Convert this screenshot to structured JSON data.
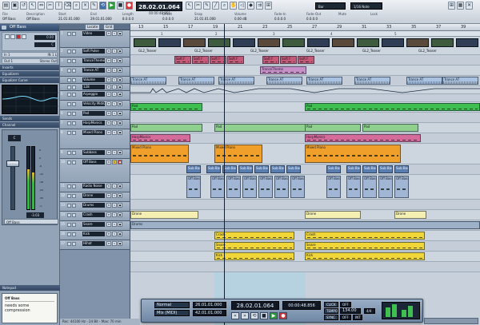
{
  "topbar": {
    "counter": "28.02.01.064",
    "sub_counter": "00:00:48.856",
    "snap_mode": "Bar",
    "quantize": "1/16 Note",
    "icons": [
      "file-icon",
      "save-icon",
      "undo-icon",
      "cursor-icon",
      "range-icon",
      "cut-icon",
      "glue-icon",
      "erase-icon",
      "zoom-icon",
      "mute-icon",
      "pencil-icon",
      "play-icon",
      "stop-icon",
      "record-icon"
    ],
    "info": [
      {
        "h": "File",
        "v": "Off Bass"
      },
      {
        "h": "Description",
        "v": "Off Bass"
      },
      {
        "h": "Start",
        "v": "21.01.01.000"
      },
      {
        "h": "End",
        "v": "29.01.01.000"
      },
      {
        "h": "Length",
        "v": "8.0.0.0"
      },
      {
        "h": "Offset",
        "v": "0.0.0.0"
      },
      {
        "h": "Snap",
        "v": "21.01.01.000"
      },
      {
        "h": "Volume",
        "v": "0.00 dB"
      },
      {
        "h": "Fade-In",
        "v": "0.0.0.0"
      },
      {
        "h": "Fade-Out",
        "v": "0.0.0.0"
      },
      {
        "h": "Mute",
        "v": ""
      },
      {
        "h": "Lock",
        "v": ""
      }
    ]
  },
  "inspector": {
    "track_name": "Off Bass",
    "rows": [
      "Volume",
      "Pan"
    ],
    "in_label": "In 1",
    "in_value": "IN 1 L",
    "out_label": "Out 1",
    "out_value": "Stereo Out",
    "sections": {
      "inserts": "Inserts",
      "equalizers": "Equalizers",
      "eq_curve": "Equalizer Curve",
      "sends": "Sends",
      "channel": "Channel",
      "notepad": "Notepad"
    },
    "fader_value": "-3.03",
    "fader_left": "0.00",
    "channel_name": "Off Bass",
    "notepad_title": "Off Bass",
    "notepad_text": "needs some compression"
  },
  "tracklist": {
    "header_label": "Locate",
    "header_value": "Grid",
    "tracks": [
      {
        "num": "1",
        "name": "Video",
        "h": 22
      },
      {
        "num": "2",
        "name": "Soft Pulse",
        "h": 12
      },
      {
        "num": "3",
        "name": "TranceTheme",
        "h": 12
      },
      {
        "num": "4",
        "name": "Trance AT",
        "h": 12
      },
      {
        "num": "",
        "name": "Volume",
        "h": 9
      },
      {
        "num": "",
        "name": "128",
        "h": 9
      },
      {
        "num": "5",
        "name": "Arpeggio",
        "h": 12
      },
      {
        "num": "",
        "name": "Velocity MidiControl",
        "h": 12
      },
      {
        "num": "6",
        "name": "Pad",
        "h": 12
      },
      {
        "num": "7",
        "name": "HarpMonics",
        "h": 12
      },
      {
        "num": "8",
        "name": "Mixed Piano",
        "h": 25
      },
      {
        "num": "9",
        "name": "Subbass",
        "h": 12
      },
      {
        "num": "10",
        "name": "Off Bass",
        "h": 30
      },
      {
        "num": "11",
        "name": "Radio Noise",
        "h": 12
      },
      {
        "num": "12",
        "name": "Drone",
        "h": 12
      },
      {
        "num": "13",
        "name": "Drums",
        "h": 12
      },
      {
        "num": "14",
        "name": "Crash",
        "h": 12
      },
      {
        "num": "15",
        "name": "Snare",
        "h": 12
      },
      {
        "num": "16",
        "name": "Kick",
        "h": 12
      },
      {
        "num": "17",
        "name": "Hihat",
        "h": 12
      }
    ]
  },
  "arrange": {
    "bars": [
      "13",
      "15",
      "17",
      "19",
      "21",
      "23",
      "25",
      "27",
      "29",
      "31",
      "33",
      "35",
      "37",
      "39"
    ],
    "markers": [
      "1",
      "2",
      "3",
      "4",
      "5"
    ],
    "events": {
      "video": "GL2_Teaser",
      "soft_pulse": "Soft F",
      "trance_theme": "TranceTheme",
      "trance_at": "Trance AT",
      "pad": "Pad",
      "harpmonics": "HarpMonics",
      "mixed_piano": "Mixed Piano",
      "subbass": "Sub Bass",
      "off_bass": "Off Bass",
      "drone": "Drone",
      "drums": "Drums",
      "crash": "Crash",
      "snare": "Snare",
      "kick": "Kick"
    }
  },
  "transport": {
    "mode": "Normal",
    "sync": "Mix (MIDI)",
    "left_locator": "26.01.01.000",
    "right_locator": "42.01.01.000",
    "position": "28.02.01.064",
    "time": "00:00:48.856",
    "click": "CLICK",
    "tempo_label": "TEMPO",
    "tempo": "134.00",
    "sync_label": "SYNC",
    "sig": "4/4",
    "off1": "OFF",
    "off2": "OFF",
    "int": "INT"
  },
  "status": {
    "text": "Rec: 44100 Hz - 24 Bit - Max: 70 min"
  }
}
